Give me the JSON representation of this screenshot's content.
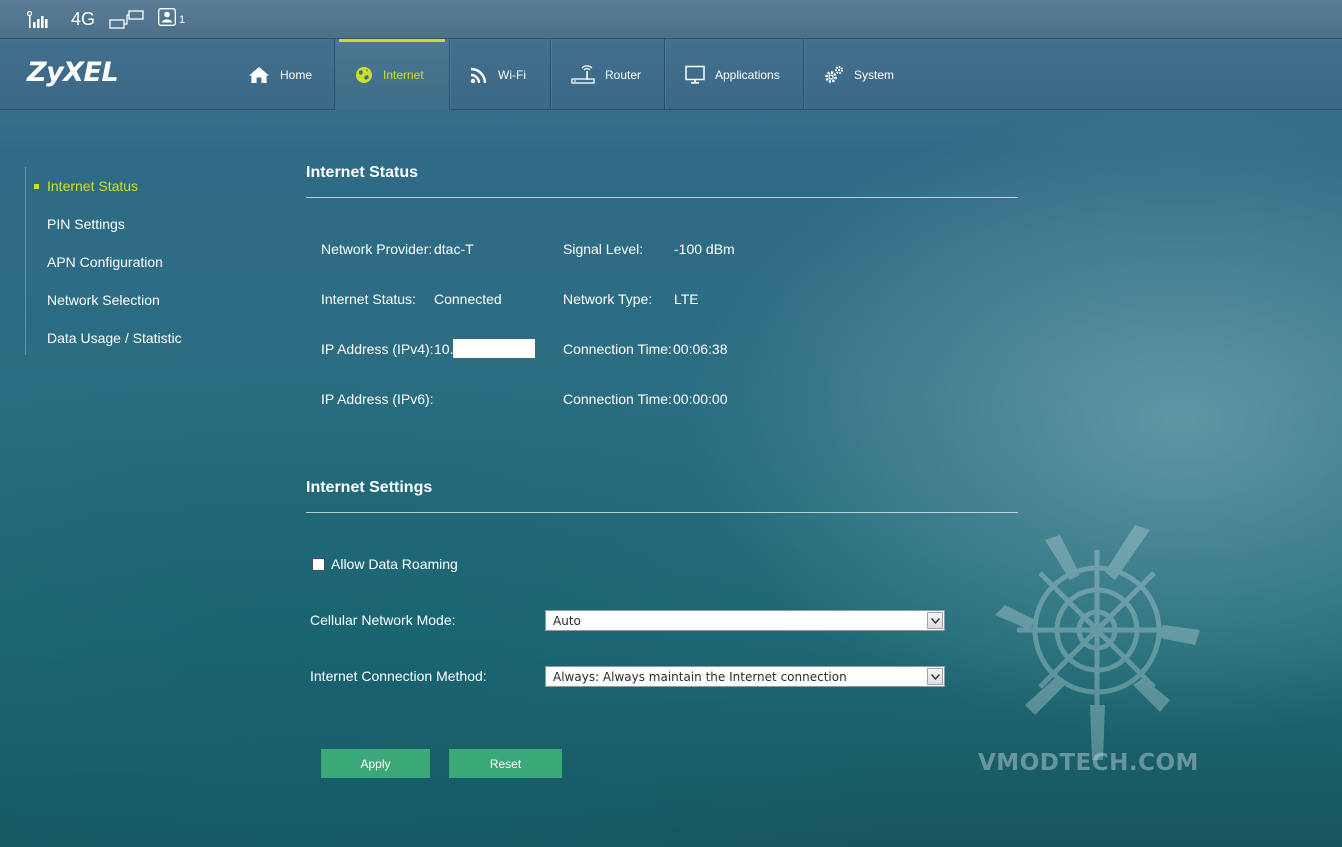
{
  "status_bar": {
    "network_type": "4G",
    "user_count": "1"
  },
  "brand": {
    "logo": "ZyXEL"
  },
  "nav": {
    "tabs": [
      {
        "label": "Home",
        "icon": "home-icon"
      },
      {
        "label": "Internet",
        "icon": "globe-icon",
        "active": true
      },
      {
        "label": "Wi-Fi",
        "icon": "wifi-icon"
      },
      {
        "label": "Router",
        "icon": "router-icon"
      },
      {
        "label": "Applications",
        "icon": "monitor-icon"
      },
      {
        "label": "System",
        "icon": "gear-icon"
      }
    ]
  },
  "sidebar": {
    "items": [
      {
        "label": "Internet Status",
        "active": true
      },
      {
        "label": "PIN Settings"
      },
      {
        "label": "APN Configuration"
      },
      {
        "label": "Network Selection"
      },
      {
        "label": "Data Usage / Statistic"
      }
    ]
  },
  "internet_status": {
    "title": "Internet Status",
    "network_provider_label": "Network Provider:",
    "network_provider_value": "dtac-T",
    "internet_status_label": "Internet Status:",
    "internet_status_value": "Connected",
    "ipv4_label": "IP Address (IPv4):",
    "ipv4_value": "10.",
    "ipv6_label": "IP Address (IPv6):",
    "ipv6_value": "",
    "signal_level_label": "Signal Level:",
    "signal_level_value": "-100 dBm",
    "network_type_label": "Network Type:",
    "network_type_value": "LTE",
    "connection_time_label_1": "Connection Time:",
    "connection_time_value_1": "00:06:38",
    "connection_time_label_2": "Connection Time:",
    "connection_time_value_2": "00:00:00"
  },
  "internet_settings": {
    "title": "Internet Settings",
    "allow_roaming_label": "Allow Data Roaming",
    "allow_roaming_checked": false,
    "cellular_mode_label": "Cellular Network Mode:",
    "cellular_mode_value": "Auto",
    "connection_method_label": "Internet Connection Method:",
    "connection_method_value": "Always: Always maintain the Internet connection",
    "apply_label": "Apply",
    "reset_label": "Reset"
  },
  "watermark": {
    "text": "VMODTECH.COM"
  },
  "colors": {
    "accent": "#cde024",
    "button": "#3ba877",
    "nav_bg": "#44708f"
  }
}
